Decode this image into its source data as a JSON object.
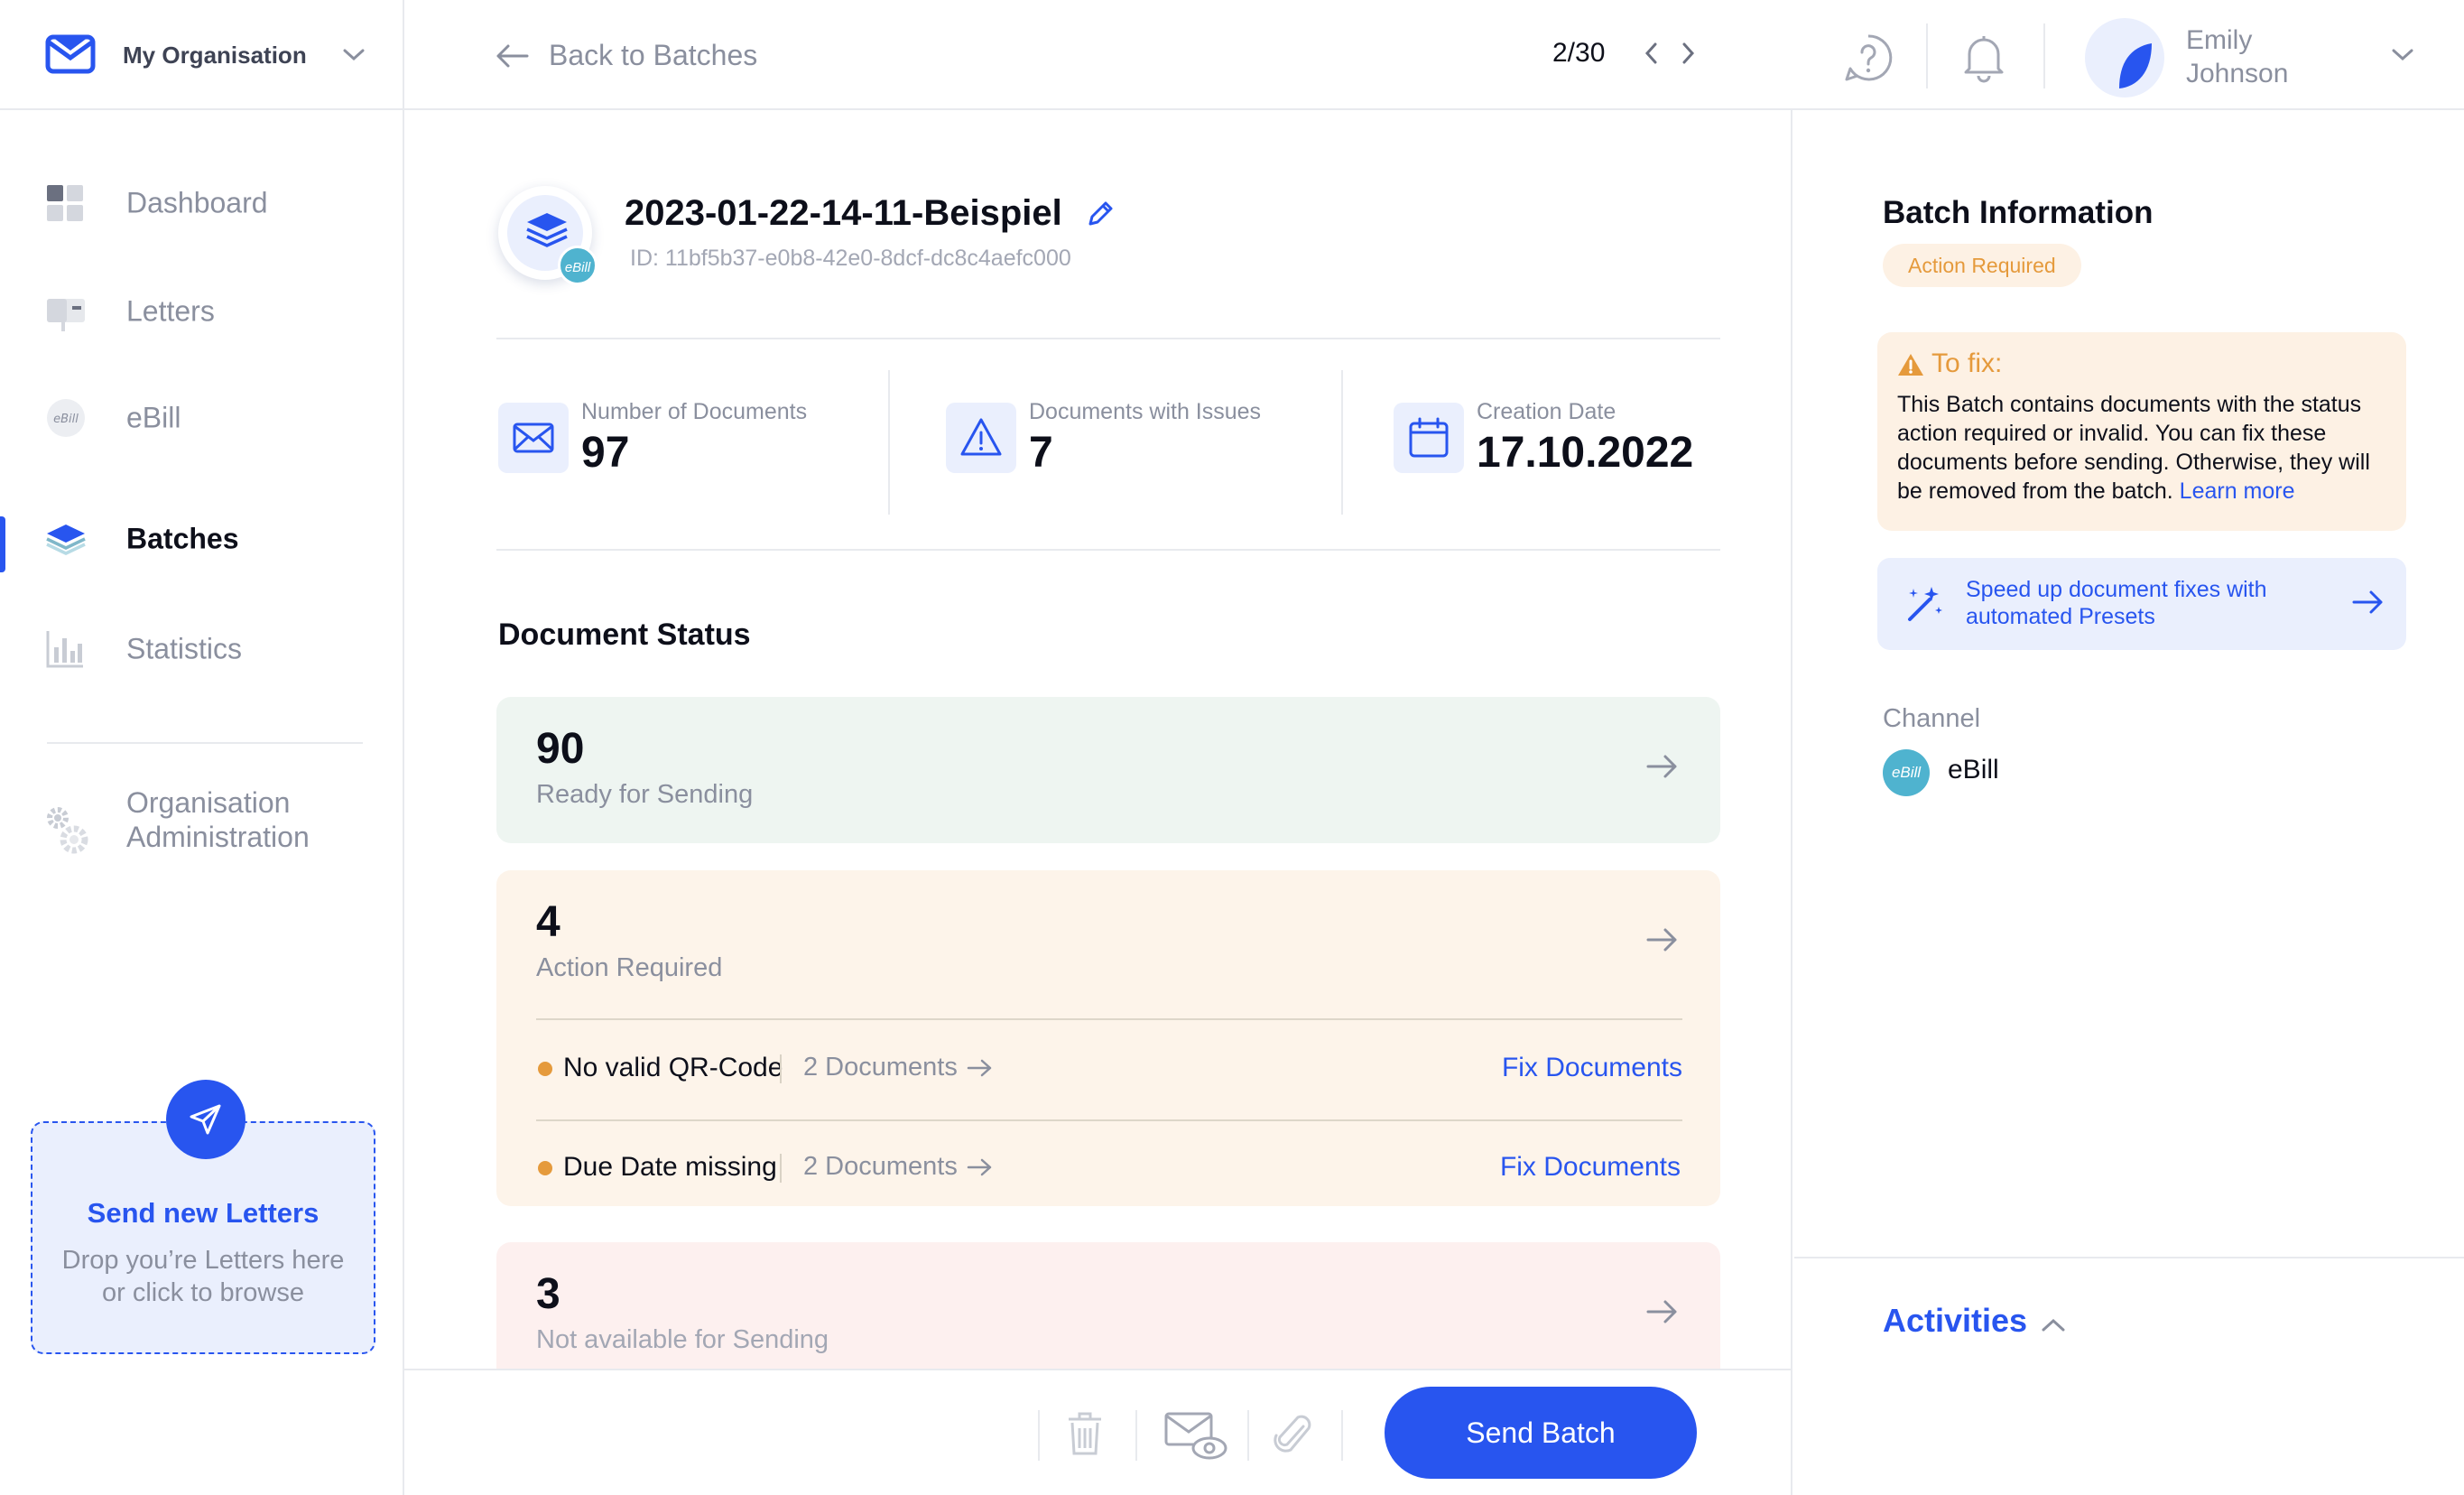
{
  "org": {
    "name": "My Organisation"
  },
  "nav": {
    "items": [
      {
        "label": "Dashboard"
      },
      {
        "label": "Letters"
      },
      {
        "label": "eBill"
      },
      {
        "label": "Batches"
      },
      {
        "label": "Statistics"
      }
    ],
    "org_admin_line1": "Organisation",
    "org_admin_line2": "Administration"
  },
  "dropzone": {
    "title": "Send new Letters",
    "line1": "Drop you’re Letters here",
    "line2": "or click to browse"
  },
  "topbar": {
    "back_label": "Back to Batches",
    "pager": "2/30"
  },
  "user": {
    "first": "Emily",
    "last": "Johnson"
  },
  "batch": {
    "title": "2023-01-22-14-11-Beispiel",
    "id": "ID: 11bf5b37-e0b8-42e0-8dcf-dc8c4aefc000",
    "badge": "eBill"
  },
  "stats": [
    {
      "label": "Number of Documents",
      "value": "97"
    },
    {
      "label": "Documents with Issues",
      "value": "7"
    },
    {
      "label": "Creation Date",
      "value": "17.10.2022"
    }
  ],
  "status": {
    "title": "Document Status",
    "ready": {
      "count": "90",
      "label": "Ready for Sending"
    },
    "action": {
      "count": "4",
      "label": "Action Required",
      "issues": [
        {
          "name": "No valid QR-Code",
          "count": "2 Documents",
          "fix": "Fix Documents"
        },
        {
          "name": "Due Date missing",
          "count": "2 Documents",
          "fix": "Fix Documents"
        }
      ]
    },
    "unavailable": {
      "count": "3",
      "label": "Not available for Sending"
    }
  },
  "footer": {
    "send_label": "Send Batch"
  },
  "info": {
    "title": "Batch Information",
    "status_pill": "Action Required",
    "fix_title": "To fix:",
    "fix_text": "This Batch contains documents with the status action required or invalid. You can fix these documents before sending. Otherwise, they will be removed from the batch.",
    "fix_link": "Learn more",
    "preset_text": "Speed up document fixes with automated Presets",
    "channel_label": "Channel",
    "channel_badge": "eBill",
    "channel_name": "eBill",
    "activities": "Activities"
  },
  "colors": {
    "accent": "#2855ef",
    "warning": "#e59a3c",
    "ebill": "#4fb3cf",
    "ready_bg": "#eef5f1",
    "action_bg": "#fdf4ea",
    "unavail_bg": "#fdf0ef"
  },
  "icons": [
    "logo-icon",
    "chevron-down-icon",
    "dashboard-icon",
    "letters-icon",
    "ebill-icon",
    "layers-icon",
    "statistics-icon",
    "gear-icon",
    "send-icon",
    "arrow-left-icon",
    "chevron-left-icon",
    "chevron-right-icon",
    "help-icon",
    "bell-icon",
    "edit-icon",
    "envelope-icon",
    "warning-icon",
    "calendar-icon",
    "arrow-right-icon",
    "trash-icon",
    "envelope-preview-icon",
    "paperclip-icon",
    "magic-wand-icon",
    "chevron-up-icon"
  ]
}
